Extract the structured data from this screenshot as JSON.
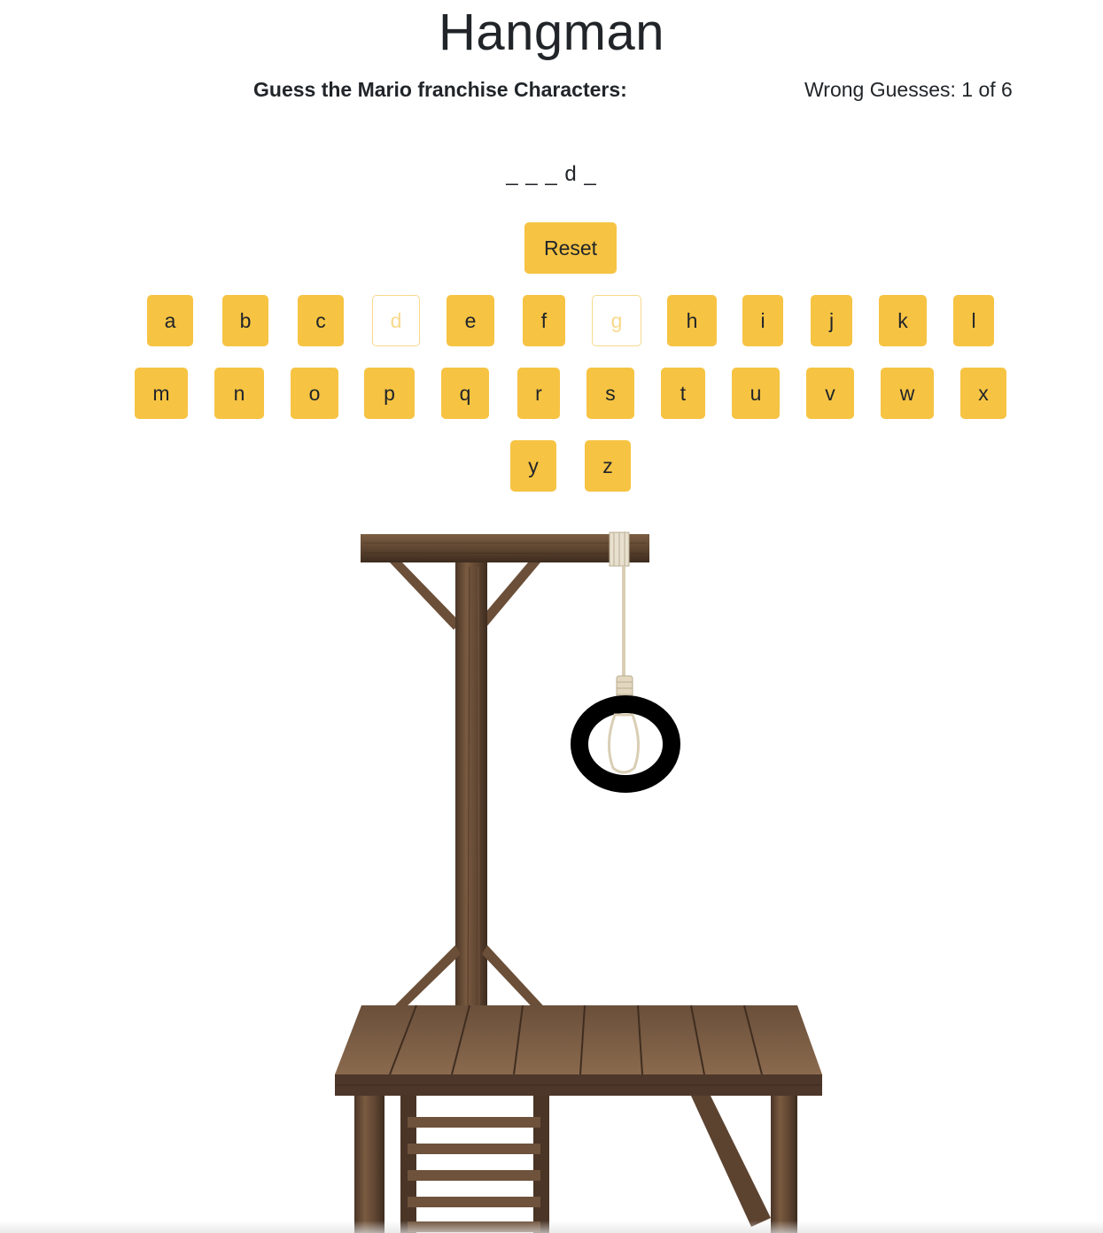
{
  "header": {
    "title": "Hangman",
    "prompt": "Guess the Mario franchise Characters:",
    "wrong_guesses": "Wrong Guesses: 1 of 6"
  },
  "word_display": "_ _ _ d _",
  "controls": {
    "reset_label": "Reset"
  },
  "keyboard": {
    "row1": [
      "a",
      "b",
      "c",
      "d",
      "e",
      "f",
      "g",
      "h",
      "i",
      "j",
      "k",
      "l"
    ],
    "row2": [
      "m",
      "n",
      "o",
      "p",
      "q",
      "r",
      "s",
      "t",
      "u",
      "v",
      "w",
      "x"
    ],
    "row3": [
      "y",
      "z"
    ],
    "guessed": [
      "d",
      "g"
    ]
  },
  "colors": {
    "button": "#f6c343",
    "button_used": "#f8d98c",
    "text": "#212529",
    "wood": "#6b4f38"
  },
  "gallows": {
    "wrong_parts_drawn": [
      "head"
    ]
  }
}
